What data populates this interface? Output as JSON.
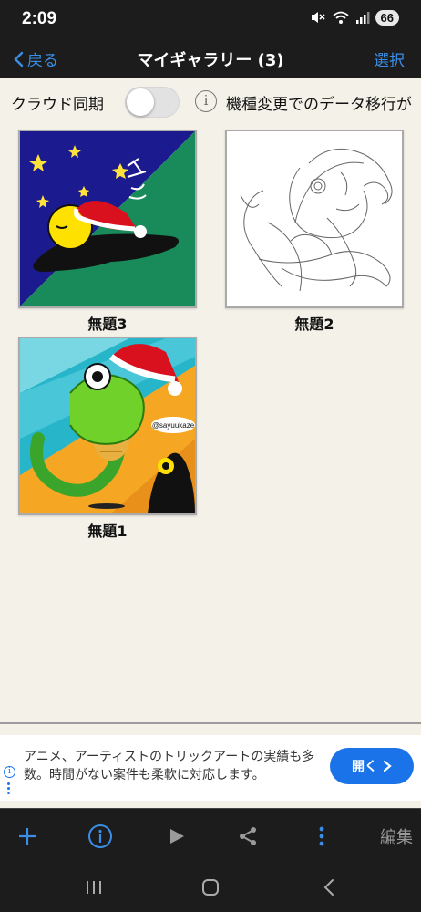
{
  "status_bar": {
    "time": "2:09",
    "battery": "66"
  },
  "nav": {
    "back_label": "戻る",
    "title": "マイギャラリー (3)",
    "select_label": "選択"
  },
  "sync": {
    "label": "クラウド同期",
    "toggle_on": false,
    "info_text": "機種変更でのデータ移行が"
  },
  "gallery": {
    "items": [
      {
        "title": "無題3"
      },
      {
        "title": "無題2"
      },
      {
        "title": "無題1",
        "watermark": "@sayuukaze"
      }
    ]
  },
  "ad": {
    "text": "アニメ、アーティストのトリックアートの実績も多数。時間がない案件も柔軟に対応します。",
    "button_label": "開く"
  },
  "toolbar": {
    "edit_label": "編集"
  },
  "colors": {
    "accent": "#3a8ee6",
    "bar": "#1c1c1c",
    "background": "#f3f1e8",
    "ad_button": "#1a73e8"
  }
}
